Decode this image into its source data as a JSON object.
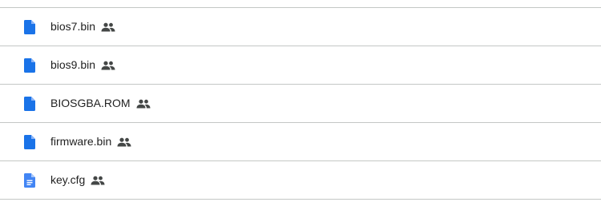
{
  "files": [
    {
      "name": "bios7.bin",
      "icon": "file-icon",
      "shared": true,
      "shared_icon": "people-icon"
    },
    {
      "name": "bios9.bin",
      "icon": "file-icon",
      "shared": true,
      "shared_icon": "people-icon"
    },
    {
      "name": "BIOSGBA.ROM",
      "icon": "file-icon",
      "shared": true,
      "shared_icon": "people-icon"
    },
    {
      "name": "firmware.bin",
      "icon": "file-icon",
      "shared": true,
      "shared_icon": "people-icon"
    },
    {
      "name": "key.cfg",
      "icon": "document-icon",
      "shared": true,
      "shared_icon": "people-icon"
    }
  ],
  "colors": {
    "file_icon": "#1a73e8",
    "document_icon": "#4285f4",
    "shared_icon": "#444746",
    "divider": "#c4c7c5",
    "text": "#1f1f1f"
  }
}
